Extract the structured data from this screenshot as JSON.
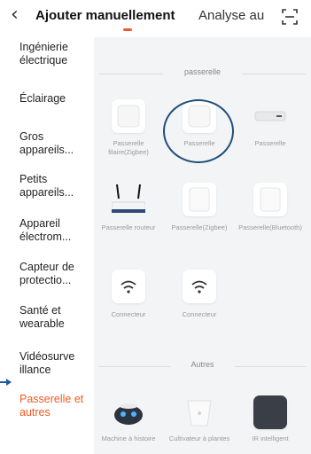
{
  "header": {
    "back_icon": "chevron-left-icon",
    "active_tab": "Ajouter manuellement",
    "other_tab": "Analyse au",
    "scan_icon": "scan-icon",
    "accent_color": "#f15a24"
  },
  "sidebar": {
    "items": [
      {
        "label": "Ingénierie électrique"
      },
      {
        "label": "Éclairage"
      },
      {
        "label": "Gros appareils..."
      },
      {
        "label": "Petits appareils..."
      },
      {
        "label": "Appareil électrom..."
      },
      {
        "label": "Capteur de protectio..."
      },
      {
        "label": "Santé et wearable"
      },
      {
        "label": "Vidéosurve illance"
      },
      {
        "label": "Passerelle et autres",
        "active": true
      }
    ]
  },
  "main": {
    "section1": "passerelle",
    "devices": [
      {
        "label": "Passerelle filaire(Zigbee)",
        "icon": "wired-gateway-icon"
      },
      {
        "label": "Passerelle",
        "icon": "gateway-icon"
      },
      {
        "label": "Passerelle",
        "icon": "gateway-bar-icon"
      },
      {
        "label": "Passerelle routeur",
        "icon": "router-icon"
      },
      {
        "label": "Passerelle(Zigbee)",
        "icon": "zigbee-gateway-icon"
      },
      {
        "label": "Passerelle(Bluetooth)",
        "icon": "bluetooth-gateway-icon"
      },
      {
        "label": "Connecteur",
        "icon": "wifi-icon"
      },
      {
        "label": "Connecteur",
        "icon": "wifi-icon"
      }
    ],
    "section2": "Autres",
    "others": [
      {
        "label": "Machine à histoire",
        "icon": "robot-icon"
      },
      {
        "label": "Cultivateur à plantes",
        "icon": "planter-icon"
      },
      {
        "label": "IR intelligent",
        "icon": "ir-remote-icon"
      }
    ]
  }
}
